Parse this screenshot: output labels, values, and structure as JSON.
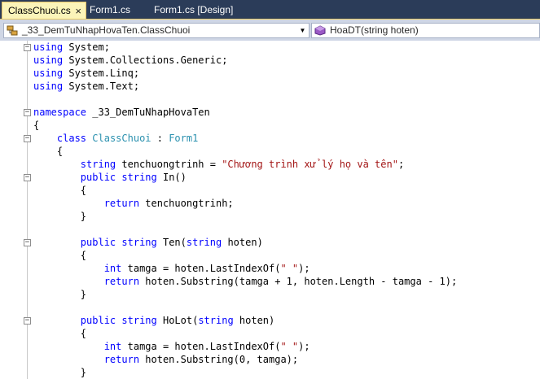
{
  "tabs": [
    {
      "label": "ClassChuoi.cs",
      "active": true
    },
    {
      "label": "Form1.cs",
      "active": false
    },
    {
      "label": "Form1.cs [Design]",
      "active": false
    }
  ],
  "tab_close_glyph": "×",
  "navigation": {
    "type_combo": {
      "value": "_33_DemTuNhapHovaTen.ClassChuoi",
      "icon": "class-icon"
    },
    "member_combo": {
      "value": "HoaDT(string hoten)",
      "icon": "method-icon"
    }
  },
  "colors": {
    "keyword": "#0000ff",
    "type": "#2b91af",
    "string": "#a31515",
    "tab_strip": "#2b3c59",
    "active_tab": "#fbf4b9"
  },
  "code": [
    [
      {
        "t": "using",
        "c": "kw"
      },
      {
        "t": " System;"
      }
    ],
    [
      {
        "t": "using",
        "c": "kw"
      },
      {
        "t": " System.Collections.Generic;"
      }
    ],
    [
      {
        "t": "using",
        "c": "kw"
      },
      {
        "t": " System.Linq;"
      }
    ],
    [
      {
        "t": "using",
        "c": "kw"
      },
      {
        "t": " System.Text;"
      }
    ],
    [],
    [
      {
        "t": "namespace",
        "c": "kw"
      },
      {
        "t": " _33_DemTuNhapHovaTen"
      }
    ],
    [
      {
        "t": "{"
      }
    ],
    [
      {
        "t": "    "
      },
      {
        "t": "class",
        "c": "kw"
      },
      {
        "t": " "
      },
      {
        "t": "ClassChuoi",
        "c": "type"
      },
      {
        "t": " : "
      },
      {
        "t": "Form1",
        "c": "type"
      }
    ],
    [
      {
        "t": "    {"
      }
    ],
    [
      {
        "t": "        "
      },
      {
        "t": "string",
        "c": "kw"
      },
      {
        "t": " tenchuongtrinh = "
      },
      {
        "t": "\"Chương trình xử lý họ và tên\"",
        "c": "str"
      },
      {
        "t": ";"
      }
    ],
    [
      {
        "t": "        "
      },
      {
        "t": "public",
        "c": "kw"
      },
      {
        "t": " "
      },
      {
        "t": "string",
        "c": "kw"
      },
      {
        "t": " In()"
      }
    ],
    [
      {
        "t": "        {"
      }
    ],
    [
      {
        "t": "            "
      },
      {
        "t": "return",
        "c": "kw"
      },
      {
        "t": " tenchuongtrinh;"
      }
    ],
    [
      {
        "t": "        }"
      }
    ],
    [],
    [
      {
        "t": "        "
      },
      {
        "t": "public",
        "c": "kw"
      },
      {
        "t": " "
      },
      {
        "t": "string",
        "c": "kw"
      },
      {
        "t": " Ten("
      },
      {
        "t": "string",
        "c": "kw"
      },
      {
        "t": " hoten)"
      }
    ],
    [
      {
        "t": "        {"
      }
    ],
    [
      {
        "t": "            "
      },
      {
        "t": "int",
        "c": "kw"
      },
      {
        "t": " tamga = hoten.LastIndexOf("
      },
      {
        "t": "\" \"",
        "c": "str"
      },
      {
        "t": ");"
      }
    ],
    [
      {
        "t": "            "
      },
      {
        "t": "return",
        "c": "kw"
      },
      {
        "t": " hoten.Substring(tamga + 1, hoten.Length - tamga - 1);"
      }
    ],
    [
      {
        "t": "        }"
      }
    ],
    [],
    [
      {
        "t": "        "
      },
      {
        "t": "public",
        "c": "kw"
      },
      {
        "t": " "
      },
      {
        "t": "string",
        "c": "kw"
      },
      {
        "t": " HoLot("
      },
      {
        "t": "string",
        "c": "kw"
      },
      {
        "t": " hoten)"
      }
    ],
    [
      {
        "t": "        {"
      }
    ],
    [
      {
        "t": "            "
      },
      {
        "t": "int",
        "c": "kw"
      },
      {
        "t": " tamga = hoten.LastIndexOf("
      },
      {
        "t": "\" \"",
        "c": "str"
      },
      {
        "t": ");"
      }
    ],
    [
      {
        "t": "            "
      },
      {
        "t": "return",
        "c": "kw"
      },
      {
        "t": " hoten.Substring(0, tamga);"
      }
    ],
    [
      {
        "t": "        }"
      }
    ]
  ],
  "folds": [
    {
      "line": 0,
      "glyph": "−"
    },
    {
      "line": 5,
      "glyph": "−"
    },
    {
      "line": 7,
      "glyph": "−"
    },
    {
      "line": 10,
      "glyph": "−"
    },
    {
      "line": 15,
      "glyph": "−"
    },
    {
      "line": 21,
      "glyph": "−"
    }
  ]
}
